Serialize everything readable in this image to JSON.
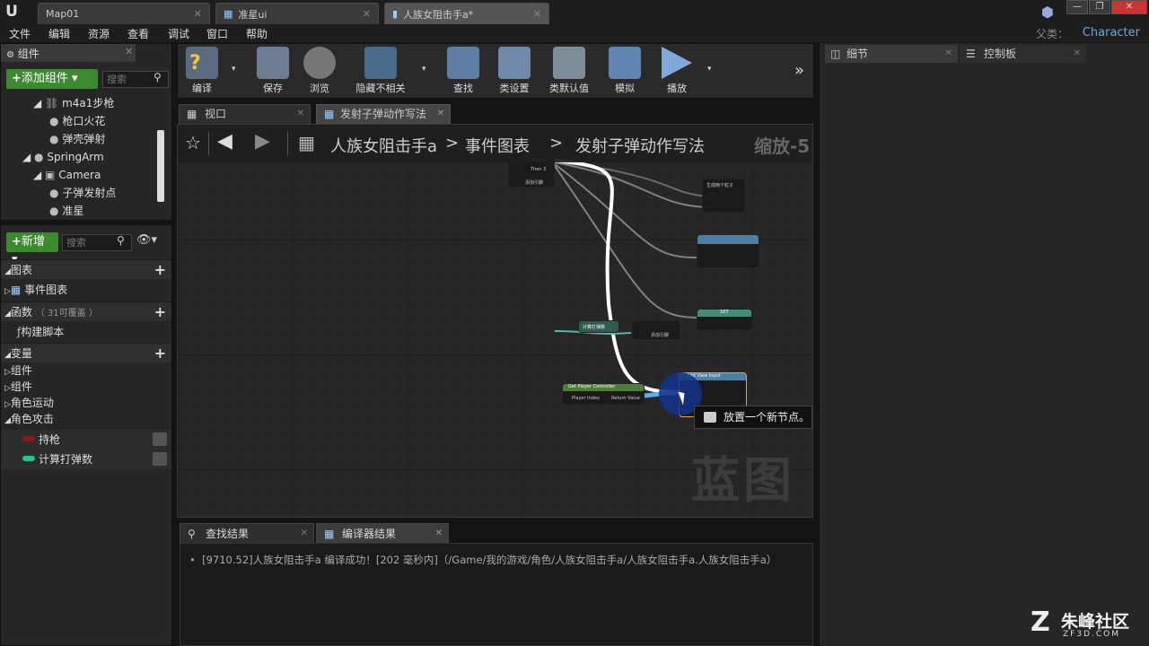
{
  "titlebar": {
    "tabs": [
      {
        "label": "Map01"
      },
      {
        "label": "准星ui"
      },
      {
        "label": "人族女阻击手a*"
      }
    ]
  },
  "menu": {
    "items": [
      "文件",
      "编辑",
      "资源",
      "查看",
      "调试",
      "窗口",
      "帮助"
    ],
    "parent_label": "父类：",
    "parent_value": "Character"
  },
  "components": {
    "title": "组件",
    "add_button": "添加组件",
    "search_placeholder": "搜索",
    "tree": [
      "m4a1步枪",
      "枪口火花",
      "弹壳弹射",
      "SpringArm",
      "Camera",
      "子弹发射点",
      "准星"
    ]
  },
  "mybp": {
    "new_button": "新增",
    "search_placeholder": "搜索",
    "graphs_header": "图表",
    "event_graph": "事件图表",
    "functions_header": "函数",
    "functions_count": "（ 31可覆盖 ）",
    "construction_script": "构建脚本",
    "variables_header": "变量",
    "var_groups": [
      "组件",
      "组件",
      "角色运动",
      "角色攻击"
    ],
    "vars": [
      {
        "name": "持枪",
        "color": "#8b1a1a"
      },
      {
        "name": "计算打弹数",
        "color": "#1bc98e"
      }
    ]
  },
  "toolbar": {
    "buttons": [
      "编译",
      "保存",
      "浏览",
      "隐藏不相关",
      "查找",
      "类设置",
      "类默认值",
      "模拟",
      "播放"
    ]
  },
  "editor_tabs": {
    "viewport": "视口",
    "graph_tab": "发射子弹动作写法"
  },
  "graph": {
    "breadcrumb": [
      "人族女阻击手a",
      "事件图表",
      "发射子弹动作写法"
    ],
    "zoom": "缩放-5",
    "watermark": "蓝图",
    "node_texts": {
      "sequence_then2": "Then 2",
      "sequence_then3": "Then 3",
      "add_pin": "添加引脚",
      "spawn": "生成两个粒子",
      "add_pin2": "添加引脚",
      "get_player_controller": "Get Player Controller",
      "player_index": "Player Index",
      "return_value": "Return Value",
      "add_view_input": "Add View Input",
      "set": "SET",
      "calc_ammo": "计算打弹数"
    },
    "tooltip": "放置一个新节点。"
  },
  "bottom": {
    "tabs": [
      "查找结果",
      "编译器结果"
    ],
    "log": "[9710.52]人族女阻击手a 编译成功！[202 毫秒内]（/Game/我的游戏/角色/人族女阻击手a/人族女阻击手a.人族女阻击手a）"
  },
  "right": {
    "tabs": [
      "细节",
      "控制板"
    ]
  },
  "brand": {
    "name": "朱峰社区",
    "url": "ZF3D.COM"
  }
}
